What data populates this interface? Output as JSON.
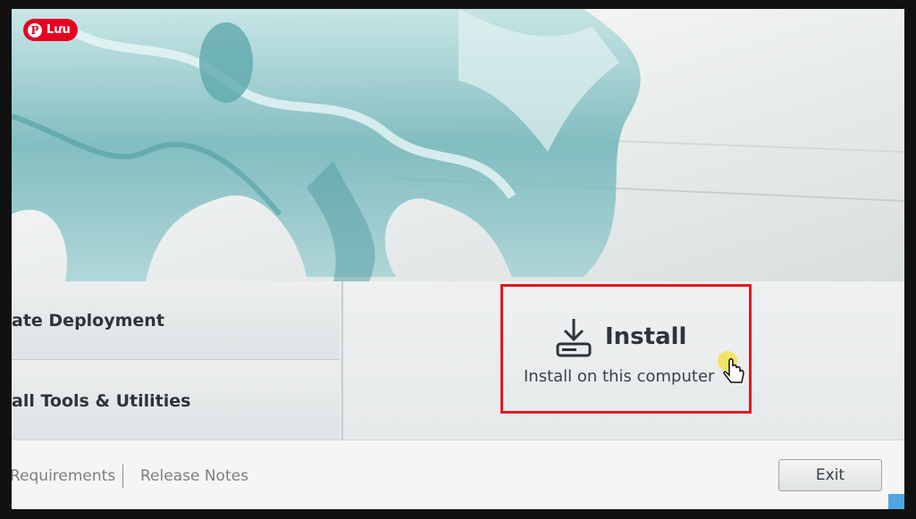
{
  "pin_button": {
    "label": "Lưu",
    "icon": "pinterest-icon"
  },
  "menu": {
    "items": [
      {
        "label": "ate Deployment"
      },
      {
        "label": "all Tools & Utilities"
      }
    ]
  },
  "install": {
    "title": "Install",
    "subtitle": "Install on this computer",
    "icon": "download-drive-icon",
    "highlight_color": "#e01a22"
  },
  "footer": {
    "links": [
      {
        "label": "Requirements"
      },
      {
        "label": "Release Notes"
      }
    ],
    "exit_label": "Exit"
  }
}
